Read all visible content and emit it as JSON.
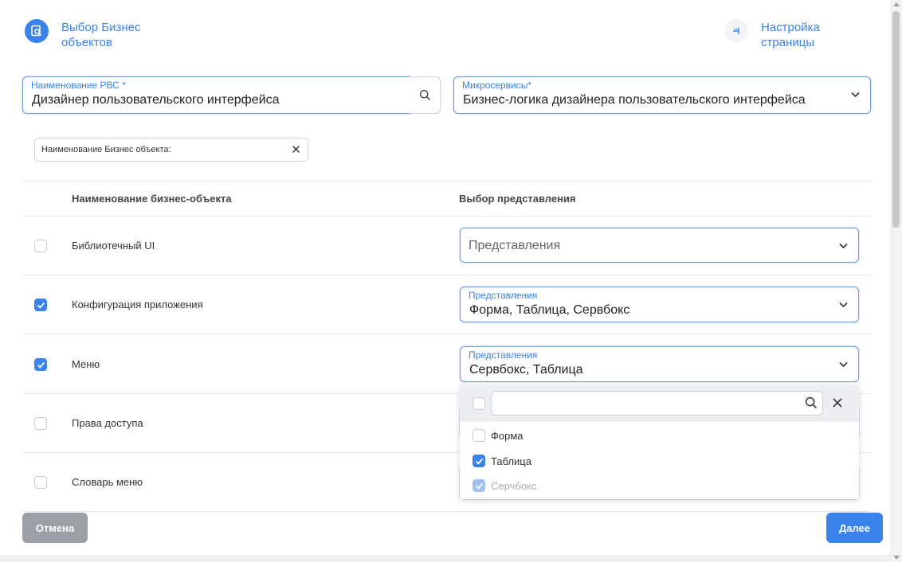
{
  "steps": {
    "select_objects": {
      "label": "Выбор Бизнес объектов",
      "icon": "document-search-icon"
    },
    "page_settings": {
      "label": "Настройка страницы",
      "icon": "page-settings-icon"
    }
  },
  "form": {
    "rbc": {
      "label": "Наименование РВС *",
      "value": "Дизайнер пользовательского интерфейса"
    },
    "microservices": {
      "label": "Микросервисы*",
      "value": "Бизнес-логика дизайнера пользовательского интерфейса"
    }
  },
  "filter": {
    "label": "Наименование Бизнес объекта:"
  },
  "table": {
    "headers": {
      "name": "Наименование бизнес-объекта",
      "view": "Выбор представления"
    },
    "rows": [
      {
        "name": "Библиотечный UI",
        "checked": false,
        "views_placeholder": "Представления"
      },
      {
        "name": "Конфигурация приложения",
        "checked": true,
        "views_label": "Представления",
        "views_value": "Форма, Таблица, Сервбокс"
      },
      {
        "name": "Меню",
        "checked": true,
        "views_label": "Представления",
        "views_value": "Сервбокс, Таблица"
      },
      {
        "name": "Права доступа",
        "checked": false
      },
      {
        "name": "Словарь меню",
        "checked": false
      }
    ]
  },
  "dropdown": {
    "search_value": "",
    "options": [
      {
        "label": "Форма",
        "checked": false,
        "disabled": false
      },
      {
        "label": "Таблица",
        "checked": true,
        "disabled": false
      },
      {
        "label": "Серчбокс",
        "checked": true,
        "disabled": true
      }
    ]
  },
  "buttons": {
    "cancel": "Отмена",
    "next": "Далее"
  },
  "colors": {
    "accent": "#3a82ec",
    "cancel": "#9aa0a6"
  }
}
